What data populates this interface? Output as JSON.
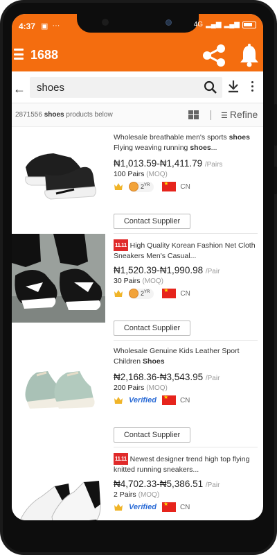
{
  "status_bar": {
    "time": "4:37",
    "extra": "···",
    "network": "4G"
  },
  "app_bar": {
    "title": "1688"
  },
  "search": {
    "query": "shoes"
  },
  "results": {
    "count": "2871556",
    "keyword": "shoes",
    "suffix": "products below",
    "refine_label": "Refine"
  },
  "products": [
    {
      "tag": "",
      "title_parts": [
        "Wholesale breathable men's sports ",
        "shoes",
        " Flying weaving running ",
        "shoes",
        "..."
      ],
      "price": "₦1,013.59-₦1,411.79",
      "unit": "/Pairs",
      "moq_qty": "100 Pairs",
      "moq_label": "(MOQ)",
      "gold_years": "2",
      "gold_sup": "YR",
      "verified": "",
      "country": "CN",
      "contact_label": "Contact Supplier"
    },
    {
      "tag": "11.11",
      "title_parts": [
        "High Quality Korean Fashion Net Cloth Sneakers Men's Casual...",
        "",
        "",
        "",
        ""
      ],
      "price": "₦1,520.39-₦1,990.98",
      "unit": "/Pair",
      "moq_qty": "30 Pairs",
      "moq_label": "(MOQ)",
      "gold_years": "2",
      "gold_sup": "YR",
      "verified": "",
      "country": "CN",
      "contact_label": "Contact Supplier"
    },
    {
      "tag": "",
      "title_parts": [
        "Wholesale Genuine Kids Leather Sport Children ",
        "Shoes",
        "",
        "",
        ""
      ],
      "price": "₦2,168.36-₦3,543.95",
      "unit": "/Pair",
      "moq_qty": "200 Pairs",
      "moq_label": "(MOQ)",
      "gold_years": "",
      "gold_sup": "",
      "verified": "Verified",
      "country": "CN",
      "contact_label": "Contact Supplier"
    },
    {
      "tag": "11.11",
      "title_parts": [
        "Newest designer trend high top flying knitted running sneakers...",
        "",
        "",
        "",
        ""
      ],
      "price": "₦4,702.33-₦5,386.51",
      "unit": "/Pair",
      "moq_qty": "2 Pairs",
      "moq_label": "(MOQ)",
      "gold_years": "",
      "gold_sup": "",
      "verified": "Verified",
      "country": "CN",
      "contact_label": ""
    }
  ],
  "colors": {
    "brand": "#f46d0f",
    "tag_red": "#e02a2a",
    "verified_blue": "#2a6bd6"
  }
}
